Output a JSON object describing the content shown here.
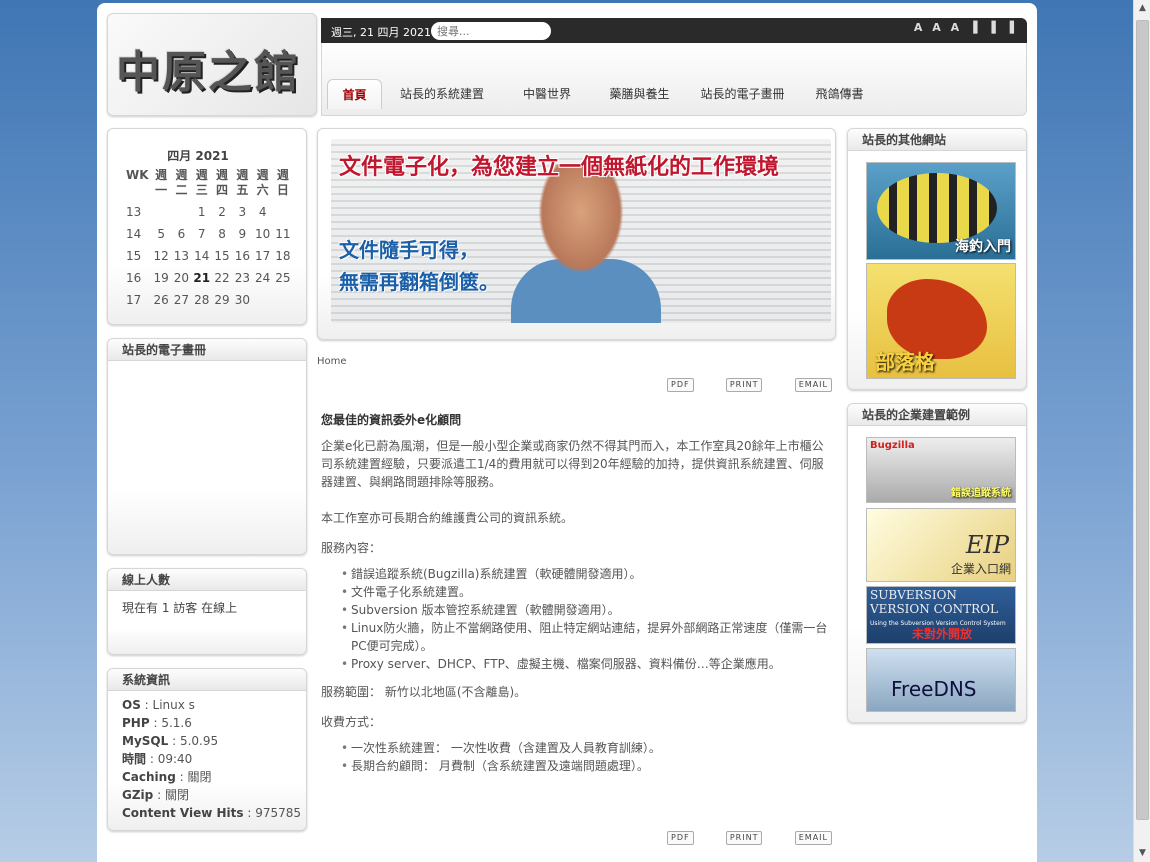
{
  "header": {
    "logo": "中原之館",
    "date": "週三, 21 四月 2021",
    "search_placeholder": "搜尋...",
    "font_controls": "A A A ▐ ▐ ▐"
  },
  "nav": {
    "items": [
      "首頁",
      "站長的系統建置",
      "中醫世界",
      "藥膳與養生",
      "站長的電子畫冊",
      "飛鴿傳書"
    ]
  },
  "calendar": {
    "title": "四月 2021",
    "header": [
      "WK",
      "週一",
      "週二",
      "週三",
      "週四",
      "週五",
      "週六",
      "週日"
    ],
    "rows": [
      [
        "13",
        "",
        "",
        "1",
        "2",
        "3",
        "4"
      ],
      [
        "14",
        "5",
        "6",
        "7",
        "8",
        "9",
        "10",
        "11"
      ],
      [
        "15",
        "12",
        "13",
        "14",
        "15",
        "16",
        "17",
        "18"
      ],
      [
        "16",
        "19",
        "20",
        "21",
        "22",
        "23",
        "24",
        "25"
      ],
      [
        "17",
        "26",
        "27",
        "28",
        "29",
        "30",
        "",
        ""
      ]
    ],
    "today": "21"
  },
  "ebook": {
    "title": "站長的電子畫冊"
  },
  "online": {
    "title": "線上人數",
    "text": "現在有 1 訪客 在線上"
  },
  "sysinfo": {
    "title": "系統資訊",
    "rows": [
      {
        "k": "OS",
        "v": " : Linux s"
      },
      {
        "k": "PHP",
        "v": " : 5.1.6"
      },
      {
        "k": "MySQL",
        "v": " : 5.0.95"
      },
      {
        "k": "時間",
        "v": " : 09:40"
      },
      {
        "k": "Caching",
        "v": " : 關閉"
      },
      {
        "k": "GZip",
        "v": " : 關閉"
      },
      {
        "k": "Content View Hits",
        "v": " : 975785"
      }
    ]
  },
  "banner": {
    "headline": "文件電子化，為您建立一個無紙化的工作環境",
    "line1": "文件隨手可得，",
    "line2": "無需再翻箱倒篋。"
  },
  "breadcrumb": "Home",
  "icons": {
    "pdf": "PDF",
    "print": "PRINT",
    "email": "EMAIL"
  },
  "article": {
    "title": "您最佳的資訊委外e化顧問",
    "intro": "企業e化已蔚為風潮，但是一般小型企業或商家仍然不得其門而入，本工作室具20餘年上市櫃公司系統建置經驗，只要派遣工1/4的費用就可以得到20年經驗的加持，提供資訊系統建置、伺服器建置、與網路問題排除等服務。",
    "maint": "本工作室亦可長期合約維護貴公司的資訊系統。",
    "services_label": "服務內容：",
    "services": [
      "錯誤追蹤系統(Bugzilla)系統建置（軟硬體開發適用）。",
      "文件電子化系統建置。",
      "Subversion 版本管控系統建置（軟體開發適用）。",
      "Linux防火牆，防止不當網路使用、阻止特定網站連結，提昇外部網路正常速度（僅需一台PC便可完成）。",
      "Proxy server、DHCP、FTP、虛擬主機、檔案伺服器、資料備份…等企業應用。"
    ],
    "area": "服務範圍： 新竹以北地區(不含離島)。",
    "fee_label": "收費方式：",
    "fees": [
      "一次性系統建置： 一次性收費（含建置及人員教育訓練）。",
      "長期合約顧問： 月費制（含系統建置及遠端問題處理）。"
    ]
  },
  "other_sites": {
    "title": "站長的其他網站",
    "items": [
      "海釣入門",
      "部落格"
    ]
  },
  "enterprise": {
    "title": "站長的企業建置範例",
    "items": [
      "Bugzilla",
      "錯誤追蹤系統",
      "EIP",
      "企業入口網",
      "SUBVERSION",
      "VERSION CONTROL",
      "Using the Subversion Version Control System",
      "未對外開放",
      "FreeDNS"
    ]
  }
}
